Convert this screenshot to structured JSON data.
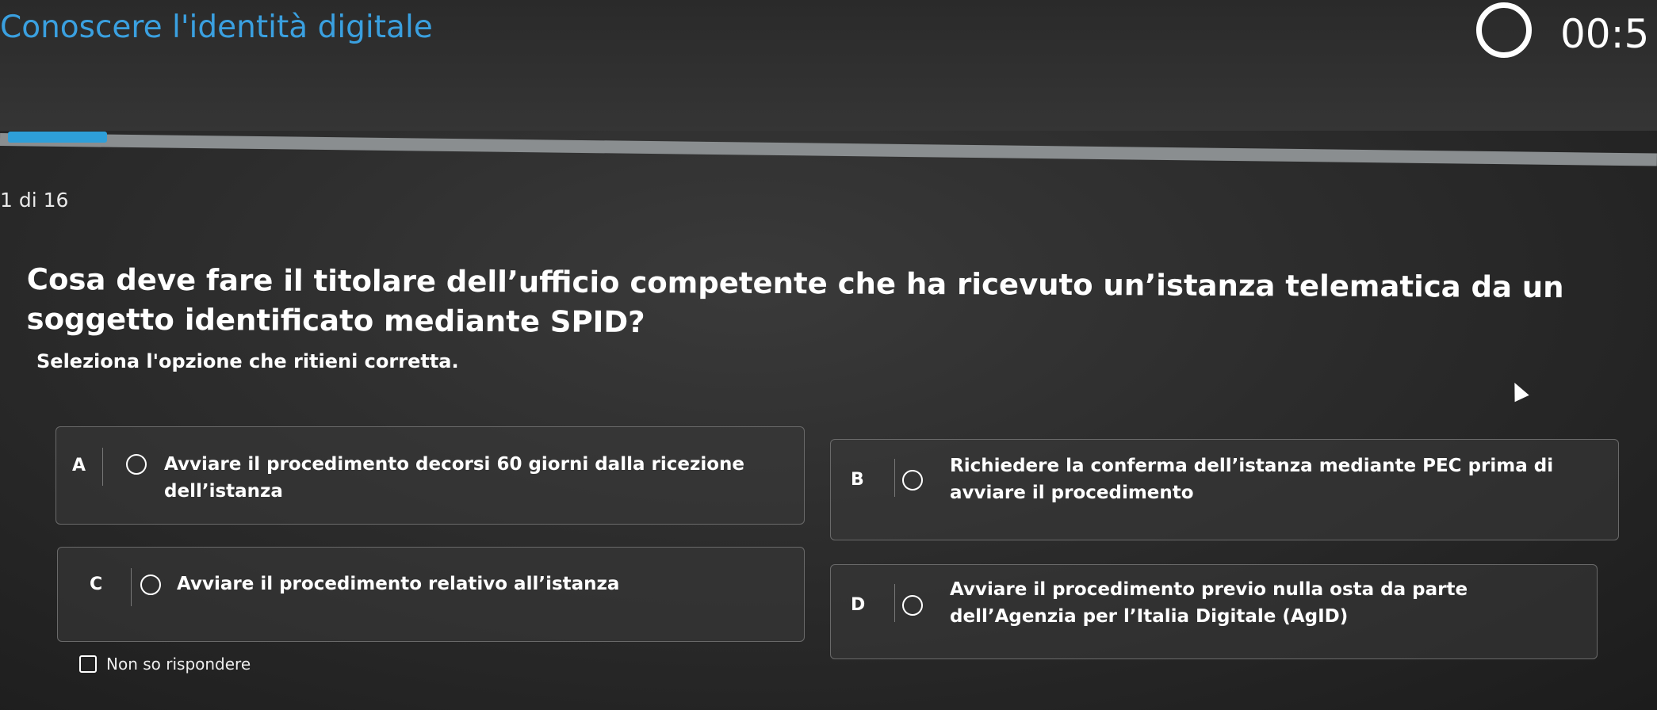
{
  "header": {
    "title": "Conoscere l'identità digitale",
    "timer": "00:5"
  },
  "progress": {
    "counter": "1 di 16",
    "fraction": 0.0625,
    "fill_color": "#2e9fd9"
  },
  "question": {
    "text": "Cosa deve fare il titolare dell’ufficio competente che ha ricevuto un’istanza telematica da un soggetto identificato mediante SPID?",
    "instruction": "Seleziona l'opzione che ritieni corretta."
  },
  "options": [
    {
      "letter": "A",
      "text": "Avviare il procedimento decorsi 60 giorni dalla ricezione dell’istanza"
    },
    {
      "letter": "B",
      "text": "Richiedere la conferma dell’istanza mediante PEC prima di avviare il procedimento"
    },
    {
      "letter": "C",
      "text": "Avviare il procedimento relativo all’istanza"
    },
    {
      "letter": "D",
      "text": "Avviare il procedimento previo nulla osta da parte dell’Agenzia per l’Italia Digitale (AgID)"
    }
  ],
  "no_answer": {
    "label": "Non so rispondere"
  },
  "colors": {
    "accent": "#3aa0e0",
    "background": "#2c2c2c"
  }
}
